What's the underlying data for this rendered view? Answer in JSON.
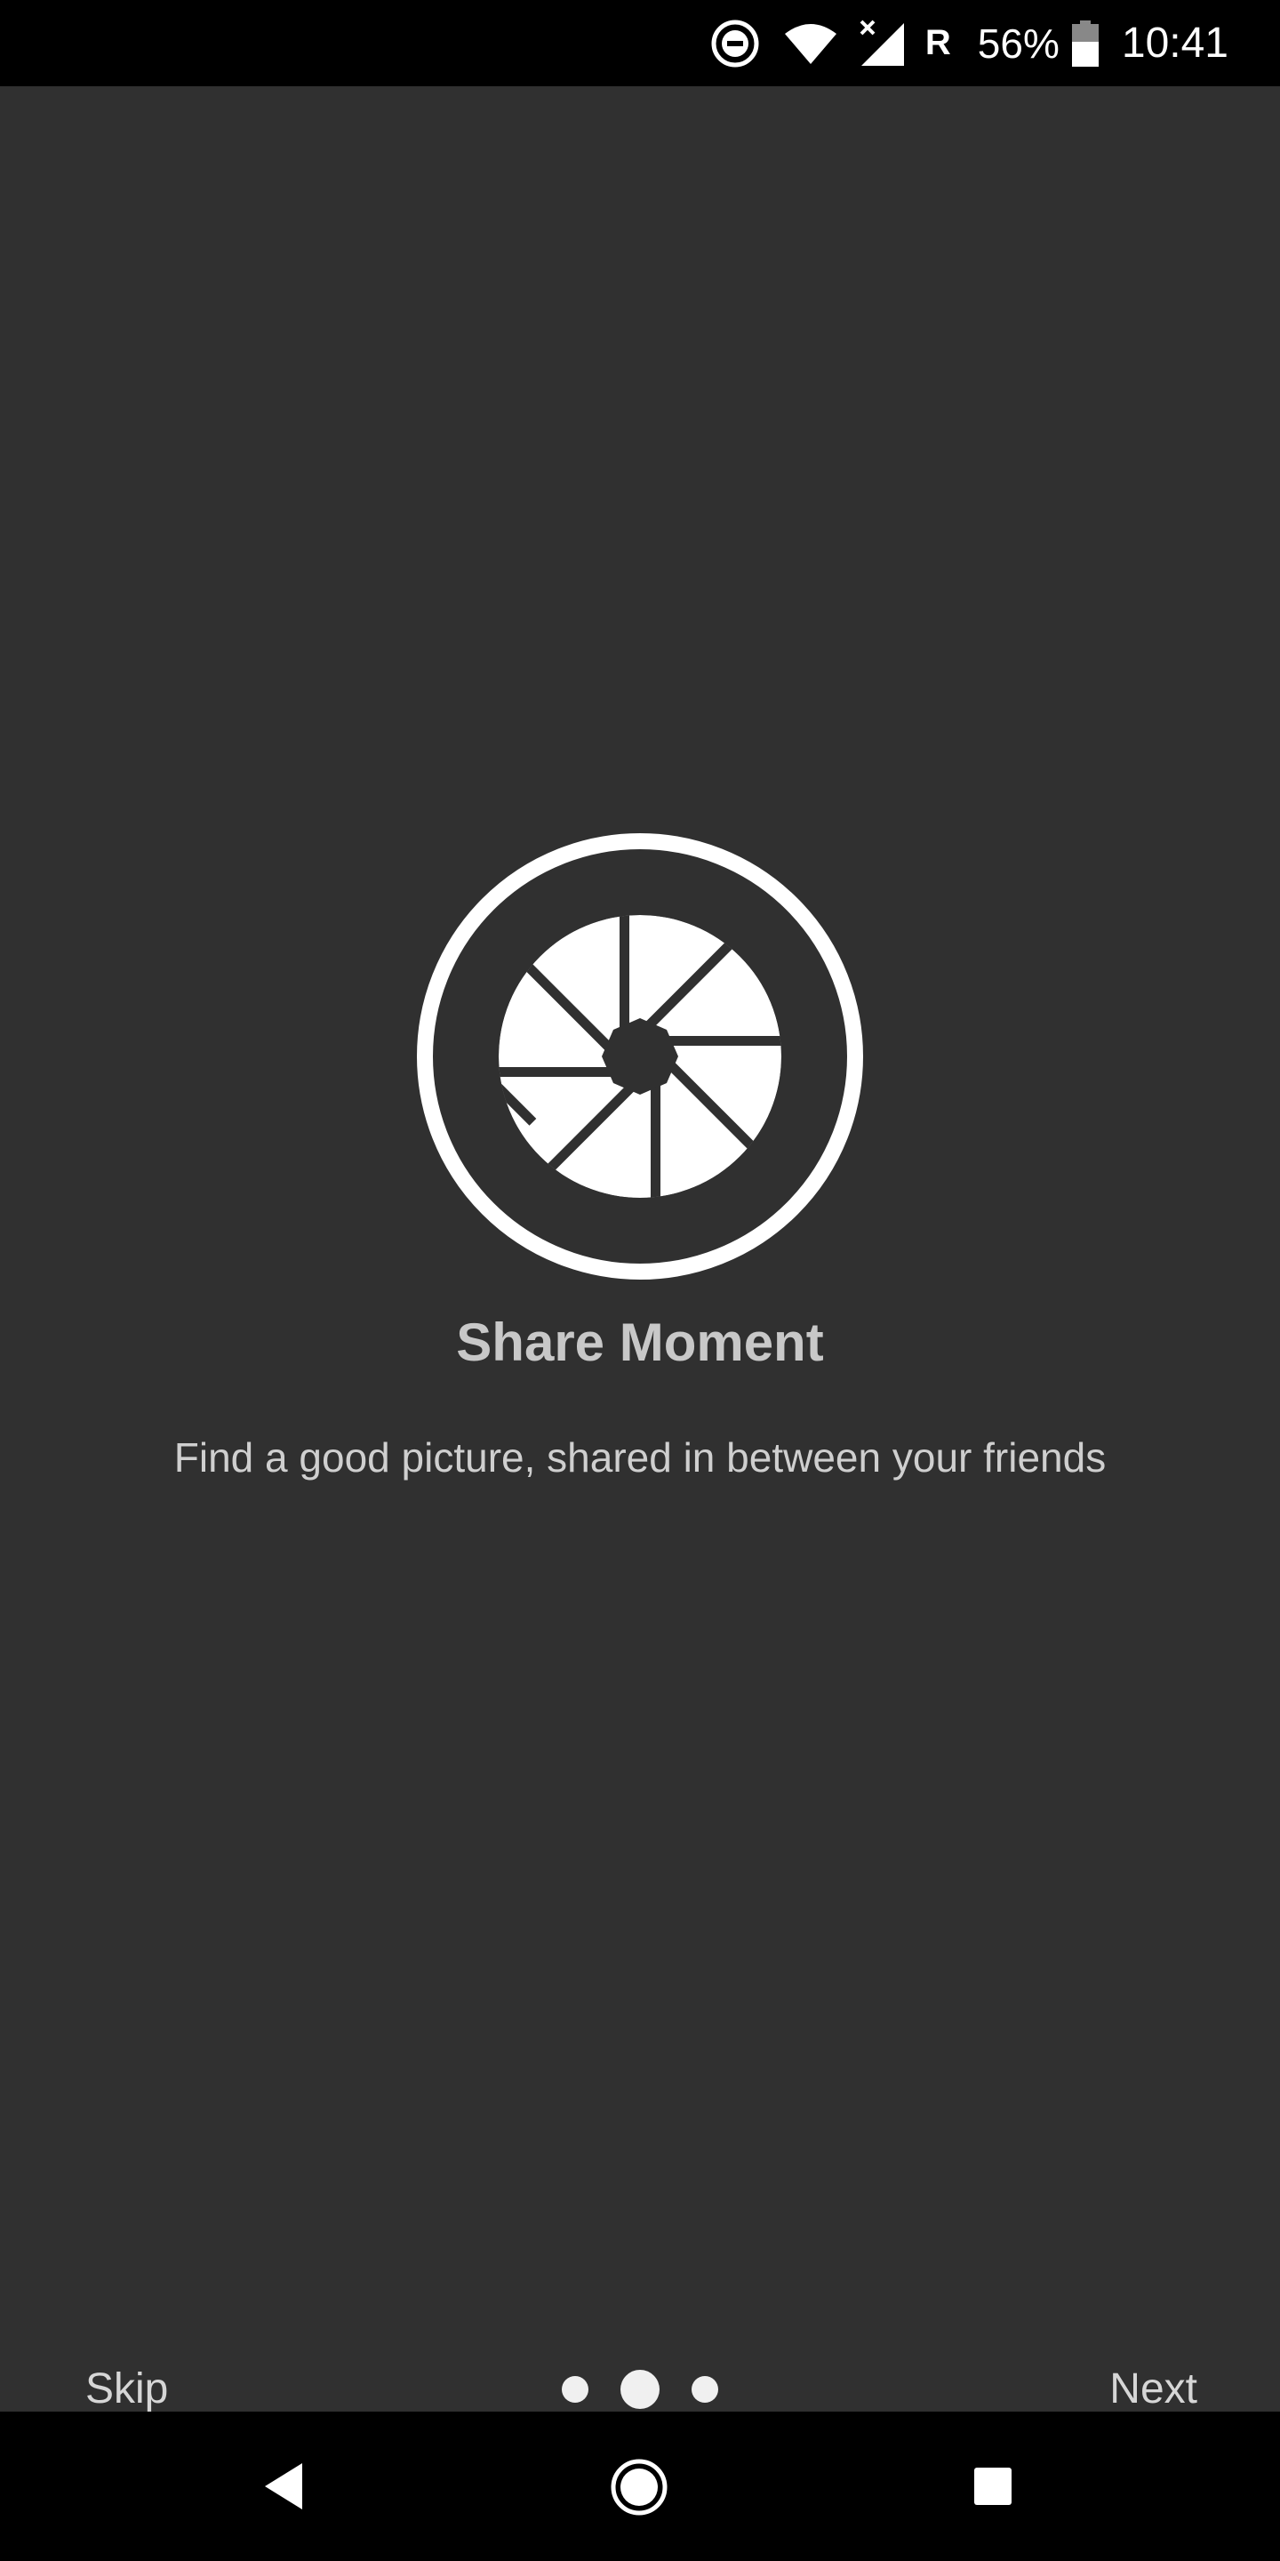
{
  "status_bar": {
    "icons": [
      "do-not-disturb-icon",
      "wifi-icon",
      "cell-signal-icon",
      "battery-icon"
    ],
    "roaming": "R",
    "battery_percent": "56%",
    "time": "10:41"
  },
  "onboarding": {
    "icon": "camera-aperture-icon",
    "title": "Share Moment",
    "subtitle": "Find a good picture, shared in between your friends",
    "skip_label": "Skip",
    "next_label": "Next",
    "page_count": 3,
    "current_page": 2
  },
  "nav_bar": {
    "icons": [
      "back-icon",
      "home-icon",
      "recents-icon"
    ]
  },
  "colors": {
    "background": "#303030",
    "bars": "#000000",
    "title": "#c8c8c8",
    "text": "#cfcfcf",
    "icon": "#ffffff"
  }
}
